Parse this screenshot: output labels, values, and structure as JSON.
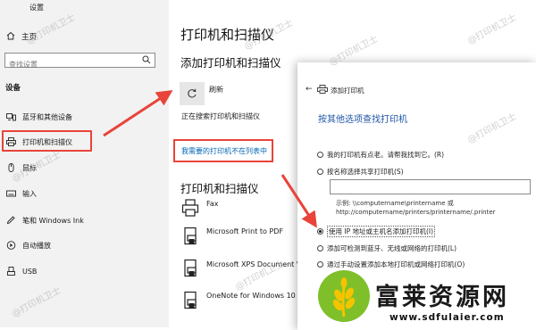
{
  "nav": {
    "window_title": "设置",
    "home_label": "主页",
    "search_placeholder": "查找设置",
    "section_label": "设备",
    "items": [
      {
        "label": "蓝牙和其他设备",
        "icon": "bluetooth-devices-icon"
      },
      {
        "label": "打印机和扫描仪",
        "icon": "printer-icon",
        "selected": true
      },
      {
        "label": "鼠标",
        "icon": "mouse-icon"
      },
      {
        "label": "输入",
        "icon": "keyboard-icon"
      },
      {
        "label": "笔和 Windows Ink",
        "icon": "pen-icon"
      },
      {
        "label": "自动播放",
        "icon": "autoplay-icon"
      },
      {
        "label": "USB",
        "icon": "usb-icon"
      }
    ]
  },
  "main": {
    "page_title": "打印机和扫描仪",
    "add_section_title": "添加打印机和扫描仪",
    "refresh_label": "刷新",
    "searching_text": "正在搜索打印机和扫描仪",
    "not_listed_link": "我需要的打印机不在列表中",
    "printers_section_title": "打印机和扫描仪",
    "printers": [
      {
        "name": "Fax"
      },
      {
        "name": "Microsoft Print to PDF"
      },
      {
        "name": "Microsoft XPS Document W"
      },
      {
        "name": "OneNote for Windows 10"
      }
    ]
  },
  "dialog": {
    "back_icon": "back-arrow-icon",
    "title": "添加打印机",
    "heading": "按其他选项查找打印机",
    "options": [
      {
        "label": "我的打印机有点老。请帮我找到它。(R)",
        "selected": false
      },
      {
        "label": "按名称选择共享打印机(S)",
        "selected": false
      },
      {
        "label": "使用 IP 地址或主机名添加打印机(I)",
        "selected": true
      },
      {
        "label": "添加可检测到蓝牙、无线或网络的打印机(L)",
        "selected": false
      },
      {
        "label": "通过手动设置添加本地打印机或网络打印机(O)",
        "selected": false
      }
    ],
    "shared_name_value": "",
    "example_line1": "示例: \\\\computername\\printername 或",
    "example_line2": "http://computername/printers/printername/.printer"
  },
  "watermark_text": "@打印机卫士",
  "logo": {
    "brand": "富莱资源网",
    "url": "www.sdfulaier.com"
  },
  "colors": {
    "highlight_red": "#e8443a",
    "link_blue": "#0066b4",
    "heading_blue": "#1f57a8",
    "nav_bg": "#f2f2f2"
  }
}
